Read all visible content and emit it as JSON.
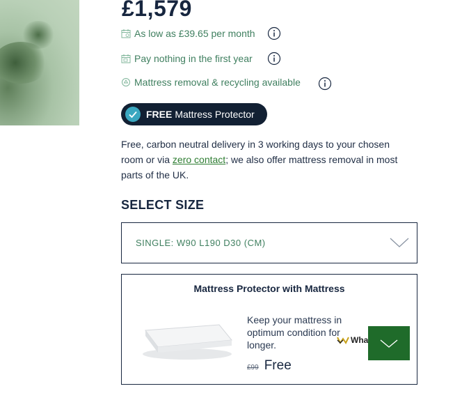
{
  "product": {
    "price": "£1,579"
  },
  "info_rows": [
    {
      "label": "As low as £39.65 per month",
      "icon": "calendar-icon"
    },
    {
      "label": "Pay nothing in the first year",
      "icon": "calendar-icon"
    },
    {
      "label": "Mattress removal & recycling available",
      "icon": "recycle-icon"
    }
  ],
  "badge": {
    "bold": "FREE",
    "text": "Mattress Protector"
  },
  "delivery": {
    "before_link": "Free, carbon neutral delivery in 3 working days to your chosen room or via ",
    "link": "zero contact",
    "after_link": "; we also offer mattress removal in most parts of the UK."
  },
  "size": {
    "heading": "SELECT SIZE",
    "selected": "SINGLE: W90 L190 D30 (CM)"
  },
  "protector": {
    "title": "Mattress Protector with Mattress",
    "description": "Keep your mattress in optimum condition for longer.",
    "old_price": "£99",
    "new_price": "Free"
  },
  "logo": {
    "text": "WhatMattress"
  },
  "colors": {
    "brand_navy": "#17263f",
    "accent_green": "#3f7f5f",
    "button_green": "#1f6b2a",
    "check_teal": "#3aa7c0"
  }
}
